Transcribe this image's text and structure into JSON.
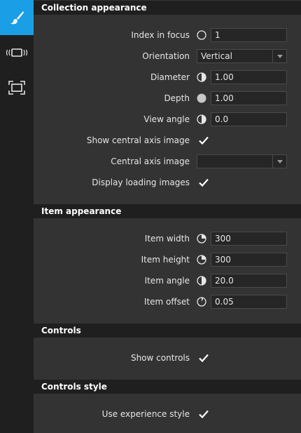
{
  "sidebar": {
    "items": [
      {
        "icon": "paintbrush-icon",
        "active": true
      },
      {
        "icon": "carousel-icon",
        "active": false
      },
      {
        "icon": "frame-icon",
        "active": false
      }
    ]
  },
  "sections": {
    "collection": {
      "title": "Collection appearance",
      "index_in_focus": {
        "label": "Index in focus",
        "value": "1",
        "icon": "circle-outline-icon"
      },
      "orientation": {
        "label": "Orientation",
        "value": "Vertical"
      },
      "diameter": {
        "label": "Diameter",
        "value": "1.00",
        "icon": "half-circle-icon"
      },
      "depth": {
        "label": "Depth",
        "value": "1.00",
        "icon": "filled-circle-icon"
      },
      "view_angle": {
        "label": "View angle",
        "value": "0.0",
        "icon": "half-circle-icon"
      },
      "show_central_axis_image": {
        "label": "Show central axis image",
        "checked": true
      },
      "central_axis_image": {
        "label": "Central axis image",
        "value": ""
      },
      "display_loading_images": {
        "label": "Display loading images",
        "checked": true
      }
    },
    "item": {
      "title": "Item appearance",
      "item_width": {
        "label": "Item width",
        "value": "300",
        "icon": "quarter-circle-icon"
      },
      "item_height": {
        "label": "Item height",
        "value": "300",
        "icon": "quarter-circle-icon"
      },
      "item_angle": {
        "label": "Item angle",
        "value": "20.0",
        "icon": "half-circle-icon"
      },
      "item_offset": {
        "label": "Item offset",
        "value": "0.05",
        "icon": "sliver-circle-icon"
      }
    },
    "controls": {
      "title": "Controls",
      "show_controls": {
        "label": "Show controls",
        "checked": true
      }
    },
    "controls_style": {
      "title": "Controls style",
      "use_experience_style": {
        "label": "Use experience style",
        "checked": true
      }
    }
  },
  "colors": {
    "accent": "#1a9fe6",
    "panel": "#333333",
    "header": "#1f1f1f"
  }
}
